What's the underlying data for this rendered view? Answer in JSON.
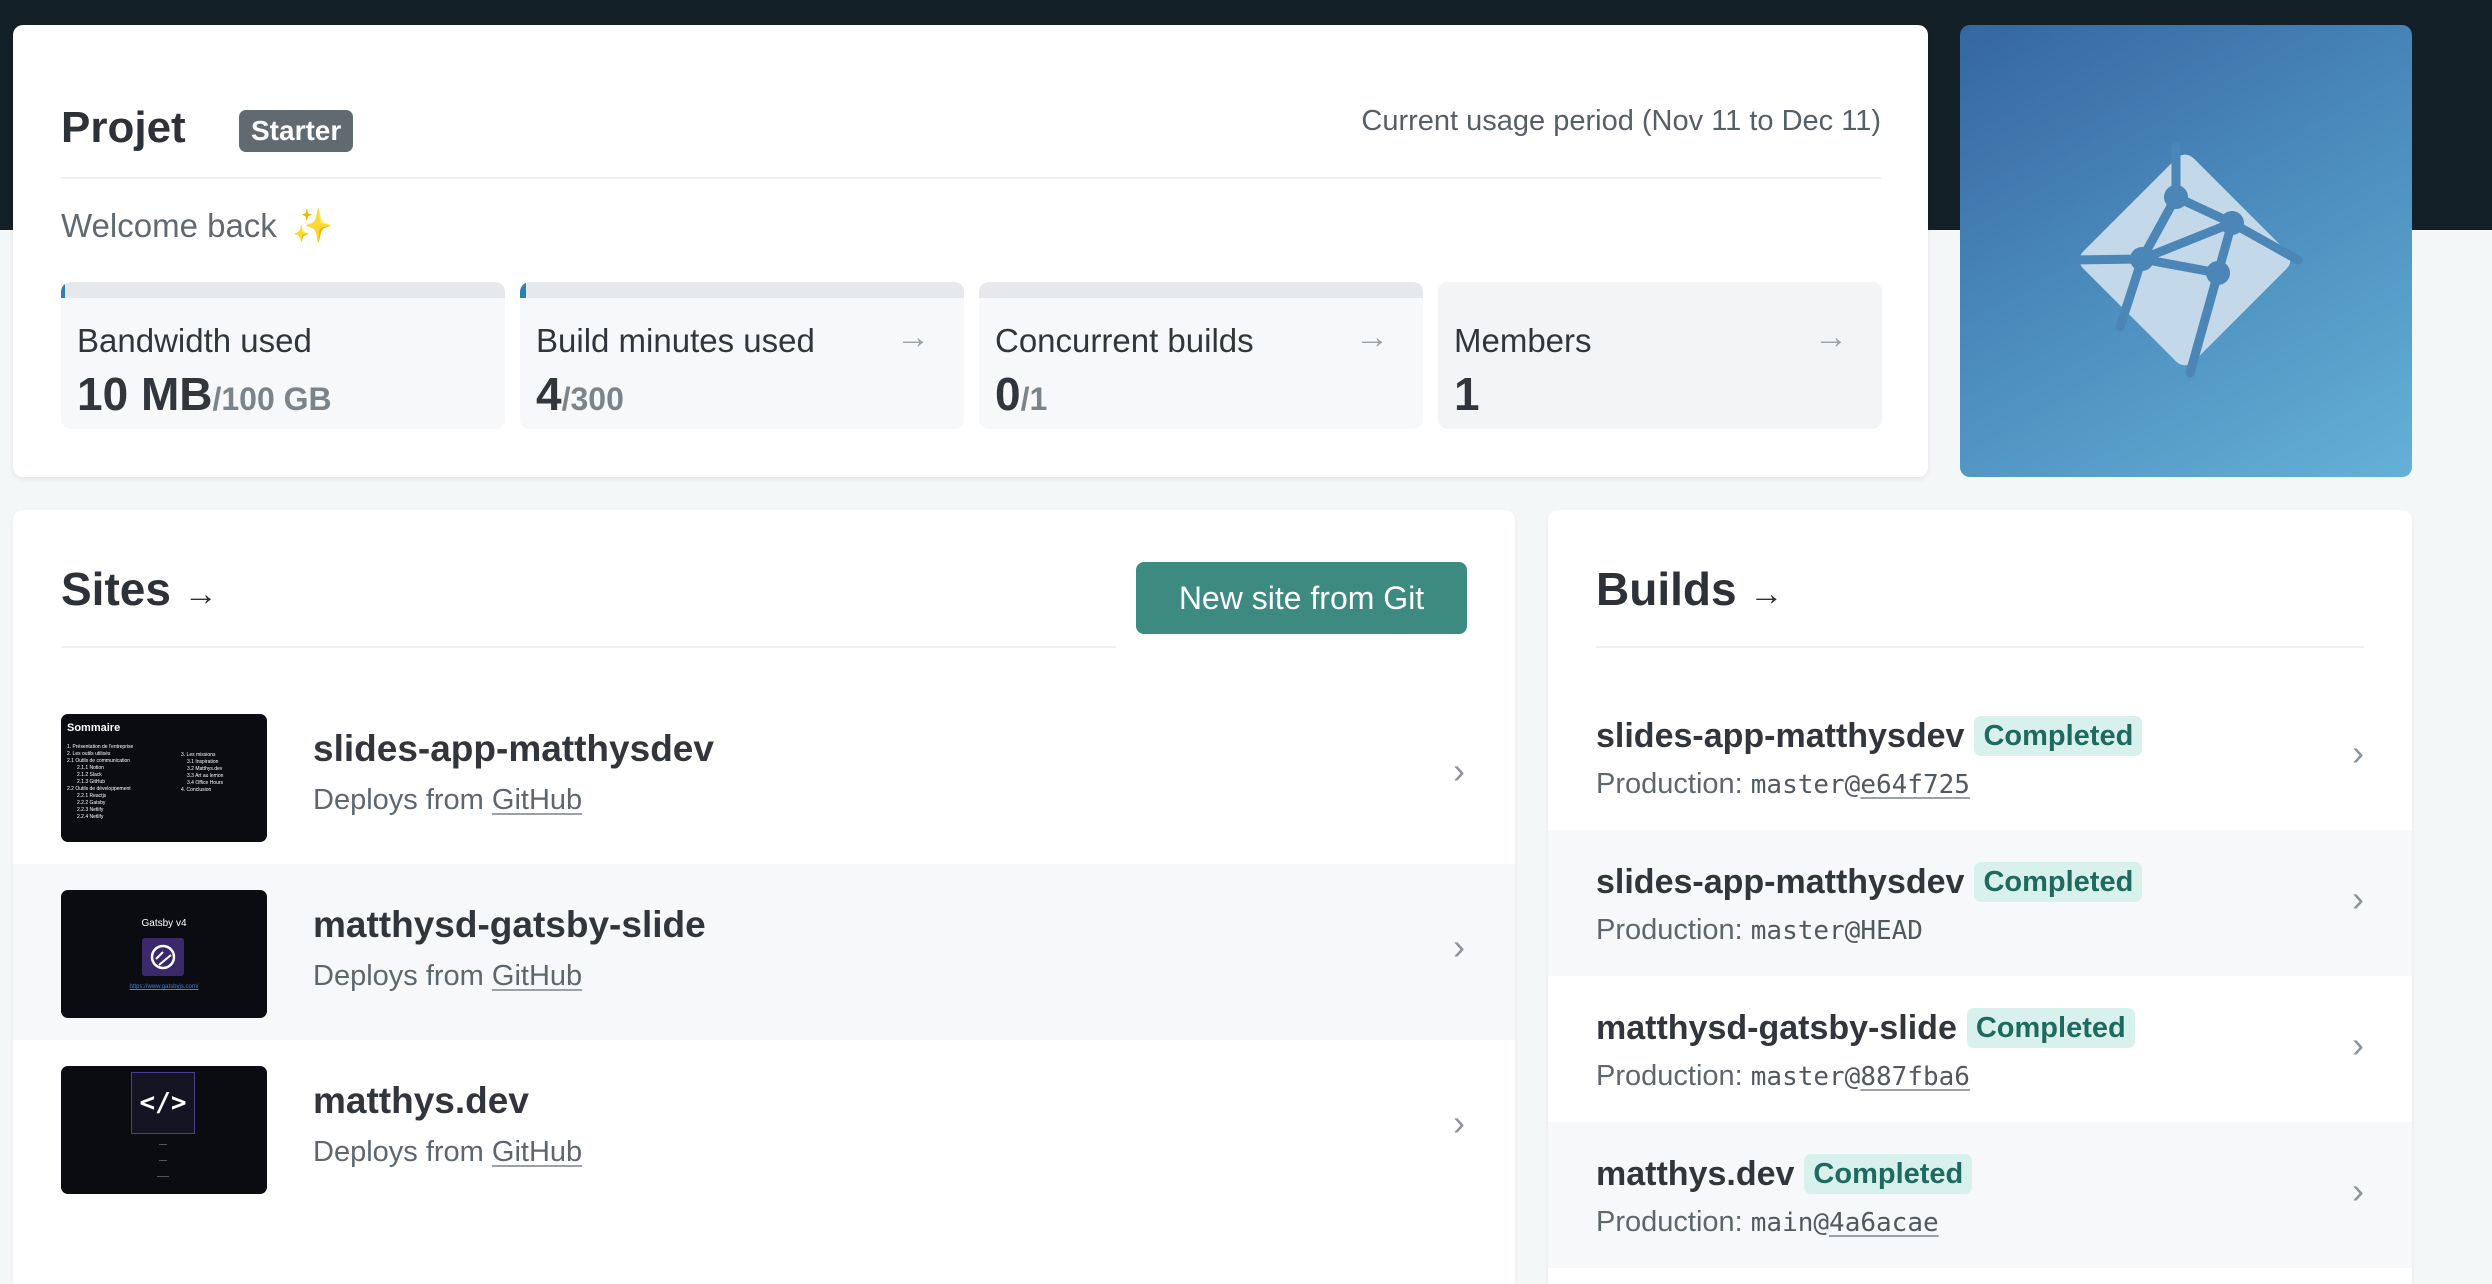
{
  "project": {
    "name": "Projet",
    "plan": "Starter",
    "usage_period": "Current usage period (Nov 11 to Dec 11)",
    "welcome": "Welcome back",
    "welcome_emoji": "✨"
  },
  "usage": [
    {
      "label": "Bandwidth used",
      "value": "10 MB",
      "limit": "/100 GB",
      "progress": 0.0001,
      "has_link": false
    },
    {
      "label": "Build minutes used",
      "value": "4",
      "limit": "/300",
      "progress": 0.013,
      "has_link": true
    },
    {
      "label": "Concurrent builds",
      "value": "0",
      "limit": "/1",
      "progress": 0,
      "has_link": true
    },
    {
      "label": "Members",
      "value": "1",
      "limit": "",
      "progress": null,
      "has_link": true
    }
  ],
  "sites": {
    "title": "Sites",
    "title_arrow": "→",
    "new_button": "New site from Git",
    "items": [
      {
        "name": "slides-app-matthysdev",
        "deploy_prefix": "Deploys from ",
        "deploy_source": "GitHub",
        "thumb": {
          "heading": "Sommaire",
          "left_lines": [
            "1. Présentation de l'entreprise",
            "2. Les outils utilisés",
            "2.1 Outils de communication",
            "2.1.1 Notion",
            "2.1.2 Slack",
            "2.1.3 GitHub",
            "2.2 Outils de développement",
            "2.2.1 Reactjs",
            "2.2.2 Gatsby",
            "2.2.3 Netlify",
            "2.2.4 Netlify"
          ],
          "right_lines": [
            "3. Les missions",
            "3.1 Inspiration",
            "3.2 Matthys.dev",
            "3.3 Art au lemon",
            "3.4 Office Hours",
            "4. Conclusion"
          ]
        }
      },
      {
        "name": "matthysd-gatsby-slide",
        "deploy_prefix": "Deploys from ",
        "deploy_source": "GitHub",
        "thumb": {
          "heading": "Gatsby v4",
          "link": "https://www.gatsbyjs.com/"
        }
      },
      {
        "name": "matthys.dev",
        "deploy_prefix": "Deploys from ",
        "deploy_source": "GitHub",
        "thumb": {
          "logo": "</>"
        }
      }
    ]
  },
  "builds": {
    "title": "Builds",
    "title_arrow": "→",
    "items": [
      {
        "site": "slides-app-matthysdev",
        "status": "Completed",
        "context": "Production: ",
        "branch": "master@",
        "ref": "e64f725",
        "ref_linked": true
      },
      {
        "site": "slides-app-matthysdev",
        "status": "Completed",
        "context": "Production: ",
        "branch": "master@",
        "ref": "HEAD",
        "ref_linked": false
      },
      {
        "site": "matthysd-gatsby-slide",
        "status": "Completed",
        "context": "Production: ",
        "branch": "master@",
        "ref": "887fba6",
        "ref_linked": true
      },
      {
        "site": "matthys.dev",
        "status": "Completed",
        "context": "Production: ",
        "branch": "main@",
        "ref": "4a6acae",
        "ref_linked": true
      }
    ]
  },
  "icons": {
    "tile_arrow": "→",
    "row_chevron": "›",
    "logo": "netlify-logo"
  },
  "colors": {
    "header_bg": "#142028",
    "primary_button": "#3c8a80",
    "status_bg": "#d9f1ec",
    "status_text": "#1e6a5f",
    "logo_gradient_start": "#3566a0",
    "logo_gradient_end": "#64b1d7"
  }
}
